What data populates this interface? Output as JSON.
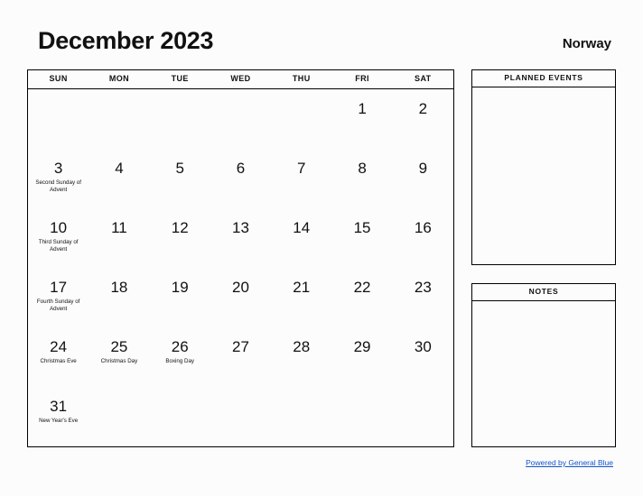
{
  "title": "December 2023",
  "country": "Norway",
  "weekday_headers": [
    "SUN",
    "MON",
    "TUE",
    "WED",
    "THU",
    "FRI",
    "SAT"
  ],
  "panels": {
    "planned_events": {
      "heading": "PLANNED EVENTS",
      "content": ""
    },
    "notes": {
      "heading": "NOTES",
      "content": ""
    }
  },
  "footer": {
    "link_label": "Powered by General Blue",
    "link_color": "#1155cc"
  },
  "colors": {
    "background": "#fcfcfc",
    "text": "#111111",
    "border": "#000000",
    "link": "#1155cc"
  },
  "calendar": {
    "month": "December",
    "year": "2023",
    "weeks": [
      [
        {
          "day": "",
          "event": ""
        },
        {
          "day": "",
          "event": ""
        },
        {
          "day": "",
          "event": ""
        },
        {
          "day": "",
          "event": ""
        },
        {
          "day": "",
          "event": ""
        },
        {
          "day": "1",
          "event": ""
        },
        {
          "day": "2",
          "event": ""
        }
      ],
      [
        {
          "day": "3",
          "event": "Second Sunday of Advent"
        },
        {
          "day": "4",
          "event": ""
        },
        {
          "day": "5",
          "event": ""
        },
        {
          "day": "6",
          "event": ""
        },
        {
          "day": "7",
          "event": ""
        },
        {
          "day": "8",
          "event": ""
        },
        {
          "day": "9",
          "event": ""
        }
      ],
      [
        {
          "day": "10",
          "event": "Third Sunday of Advent"
        },
        {
          "day": "11",
          "event": ""
        },
        {
          "day": "12",
          "event": ""
        },
        {
          "day": "13",
          "event": ""
        },
        {
          "day": "14",
          "event": ""
        },
        {
          "day": "15",
          "event": ""
        },
        {
          "day": "16",
          "event": ""
        }
      ],
      [
        {
          "day": "17",
          "event": "Fourth Sunday of Advent"
        },
        {
          "day": "18",
          "event": ""
        },
        {
          "day": "19",
          "event": ""
        },
        {
          "day": "20",
          "event": ""
        },
        {
          "day": "21",
          "event": ""
        },
        {
          "day": "22",
          "event": ""
        },
        {
          "day": "23",
          "event": ""
        }
      ],
      [
        {
          "day": "24",
          "event": "Christmas Eve"
        },
        {
          "day": "25",
          "event": "Christmas Day"
        },
        {
          "day": "26",
          "event": "Boxing Day"
        },
        {
          "day": "27",
          "event": ""
        },
        {
          "day": "28",
          "event": ""
        },
        {
          "day": "29",
          "event": ""
        },
        {
          "day": "30",
          "event": ""
        }
      ],
      [
        {
          "day": "31",
          "event": "New Year's Eve"
        },
        {
          "day": "",
          "event": ""
        },
        {
          "day": "",
          "event": ""
        },
        {
          "day": "",
          "event": ""
        },
        {
          "day": "",
          "event": ""
        },
        {
          "day": "",
          "event": ""
        },
        {
          "day": "",
          "event": ""
        }
      ]
    ]
  }
}
